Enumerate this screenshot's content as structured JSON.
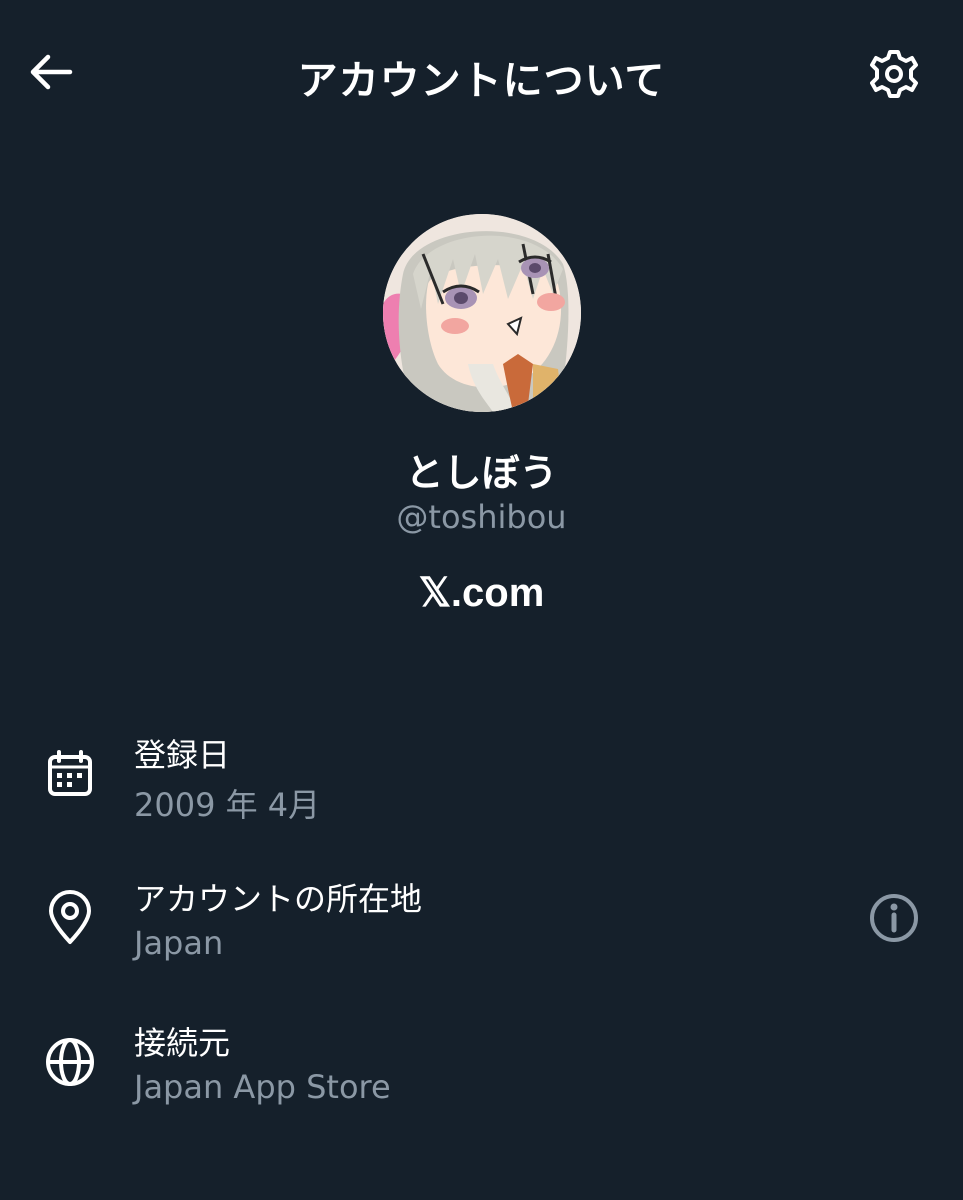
{
  "header": {
    "title": "アカウントについて",
    "back_icon": "arrow-left-icon",
    "settings_icon": "gear-icon"
  },
  "profile": {
    "display_name": "としぼう",
    "handle": "@toshibou",
    "brand": "𝕏.com"
  },
  "details": [
    {
      "icon": "calendar-icon",
      "label": "登録日",
      "value": "2009 年 4月"
    },
    {
      "icon": "location-pin-icon",
      "label": "アカウントの所在地",
      "value": "Japan",
      "info_icon": "info-icon"
    },
    {
      "icon": "globe-icon",
      "label": "接続元",
      "value": "Japan App Store"
    }
  ],
  "colors": {
    "background": "#15202b",
    "primary_text": "#ffffff",
    "secondary_text": "#8b98a5"
  }
}
